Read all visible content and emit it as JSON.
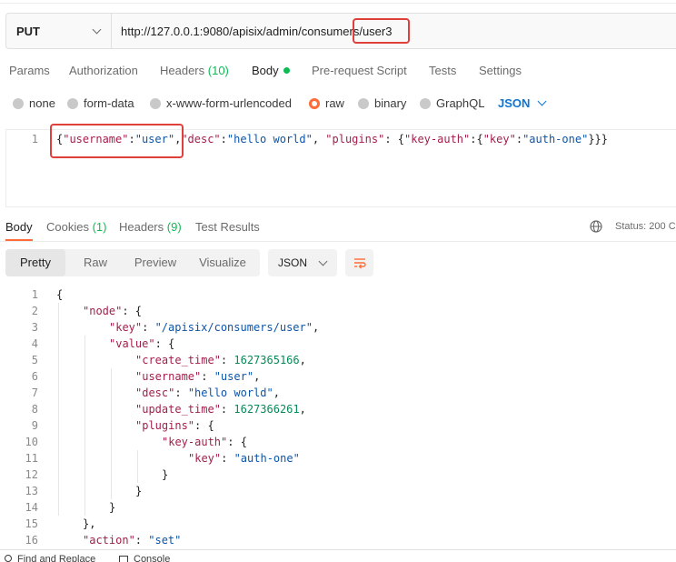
{
  "request": {
    "method": "PUT",
    "url_prefix": "http://127.0.0.1:9080/apisix/admin/consumers",
    "url_suffix": "/user3"
  },
  "request_tabs": [
    {
      "label": "Params"
    },
    {
      "label": "Authorization"
    },
    {
      "label": "Headers",
      "count": "(10)"
    },
    {
      "label": "Body"
    },
    {
      "label": "Pre-request Script"
    },
    {
      "label": "Tests"
    },
    {
      "label": "Settings"
    }
  ],
  "body_types": [
    "none",
    "form-data",
    "x-www-form-urlencoded",
    "raw",
    "binary",
    "GraphQL"
  ],
  "body_format": "JSON",
  "request_body": {
    "line_number": "1",
    "tokens": [
      "{",
      "\"username\"",
      ":",
      "\"user\"",
      ",",
      "\"desc\"",
      ":",
      "\"hello world\"",
      ", ",
      "\"plugins\"",
      ": {",
      "\"key-auth\"",
      ":{",
      "\"key\"",
      ":",
      "\"auth-one\"",
      "}}}"
    ]
  },
  "response_tabs": [
    {
      "label": "Body"
    },
    {
      "label": "Cookies",
      "count": "(1)"
    },
    {
      "label": "Headers",
      "count": "(9)"
    },
    {
      "label": "Test Results"
    }
  ],
  "status_text": "Status: 200 C",
  "view_modes": [
    "Pretty",
    "Raw",
    "Preview",
    "Visualize"
  ],
  "response_format": "JSON",
  "response_lines": [
    {
      "n": "1",
      "parts": [
        [
          "p",
          "{"
        ]
      ]
    },
    {
      "n": "2",
      "parts": [
        [
          "k",
          "\"node\""
        ],
        [
          "p",
          ": {"
        ]
      ]
    },
    {
      "n": "3",
      "parts": [
        [
          "k",
          "\"key\""
        ],
        [
          "p",
          ": "
        ],
        [
          "s",
          "\"/apisix/consumers/user\""
        ],
        [
          "p",
          ","
        ]
      ]
    },
    {
      "n": "4",
      "parts": [
        [
          "k",
          "\"value\""
        ],
        [
          "p",
          ": {"
        ]
      ]
    },
    {
      "n": "5",
      "parts": [
        [
          "k",
          "\"create_time\""
        ],
        [
          "p",
          ": "
        ],
        [
          "n",
          "1627365166"
        ],
        [
          "p",
          ","
        ]
      ]
    },
    {
      "n": "6",
      "parts": [
        [
          "k",
          "\"username\""
        ],
        [
          "p",
          ": "
        ],
        [
          "s",
          "\"user\""
        ],
        [
          "p",
          ","
        ]
      ]
    },
    {
      "n": "7",
      "parts": [
        [
          "k",
          "\"desc\""
        ],
        [
          "p",
          ": "
        ],
        [
          "s",
          "\"hello world\""
        ],
        [
          "p",
          ","
        ]
      ]
    },
    {
      "n": "8",
      "parts": [
        [
          "k",
          "\"update_time\""
        ],
        [
          "p",
          ": "
        ],
        [
          "n",
          "1627366261"
        ],
        [
          "p",
          ","
        ]
      ]
    },
    {
      "n": "9",
      "parts": [
        [
          "k",
          "\"plugins\""
        ],
        [
          "p",
          ": {"
        ]
      ]
    },
    {
      "n": "10",
      "parts": [
        [
          "k",
          "\"key-auth\""
        ],
        [
          "p",
          ": {"
        ]
      ]
    },
    {
      "n": "11",
      "parts": [
        [
          "k",
          "\"key\""
        ],
        [
          "p",
          ": "
        ],
        [
          "s",
          "\"auth-one\""
        ]
      ]
    },
    {
      "n": "12",
      "parts": [
        [
          "p",
          "}"
        ]
      ]
    },
    {
      "n": "13",
      "parts": [
        [
          "p",
          "}"
        ]
      ]
    },
    {
      "n": "14",
      "parts": [
        [
          "p",
          "}"
        ]
      ]
    },
    {
      "n": "15",
      "parts": [
        [
          "p",
          "},"
        ]
      ]
    },
    {
      "n": "16",
      "parts": [
        [
          "k",
          "\"action\""
        ],
        [
          "p",
          ": "
        ],
        [
          "s",
          "\"set\""
        ]
      ]
    }
  ],
  "bottom_bar": {
    "find_replace": "Find and Replace",
    "console": "Console"
  },
  "colors": {
    "accent": "#ff6c37",
    "highlight": "#e0403c",
    "link_blue": "#0d75d4",
    "success_green": "#0cbb52"
  }
}
